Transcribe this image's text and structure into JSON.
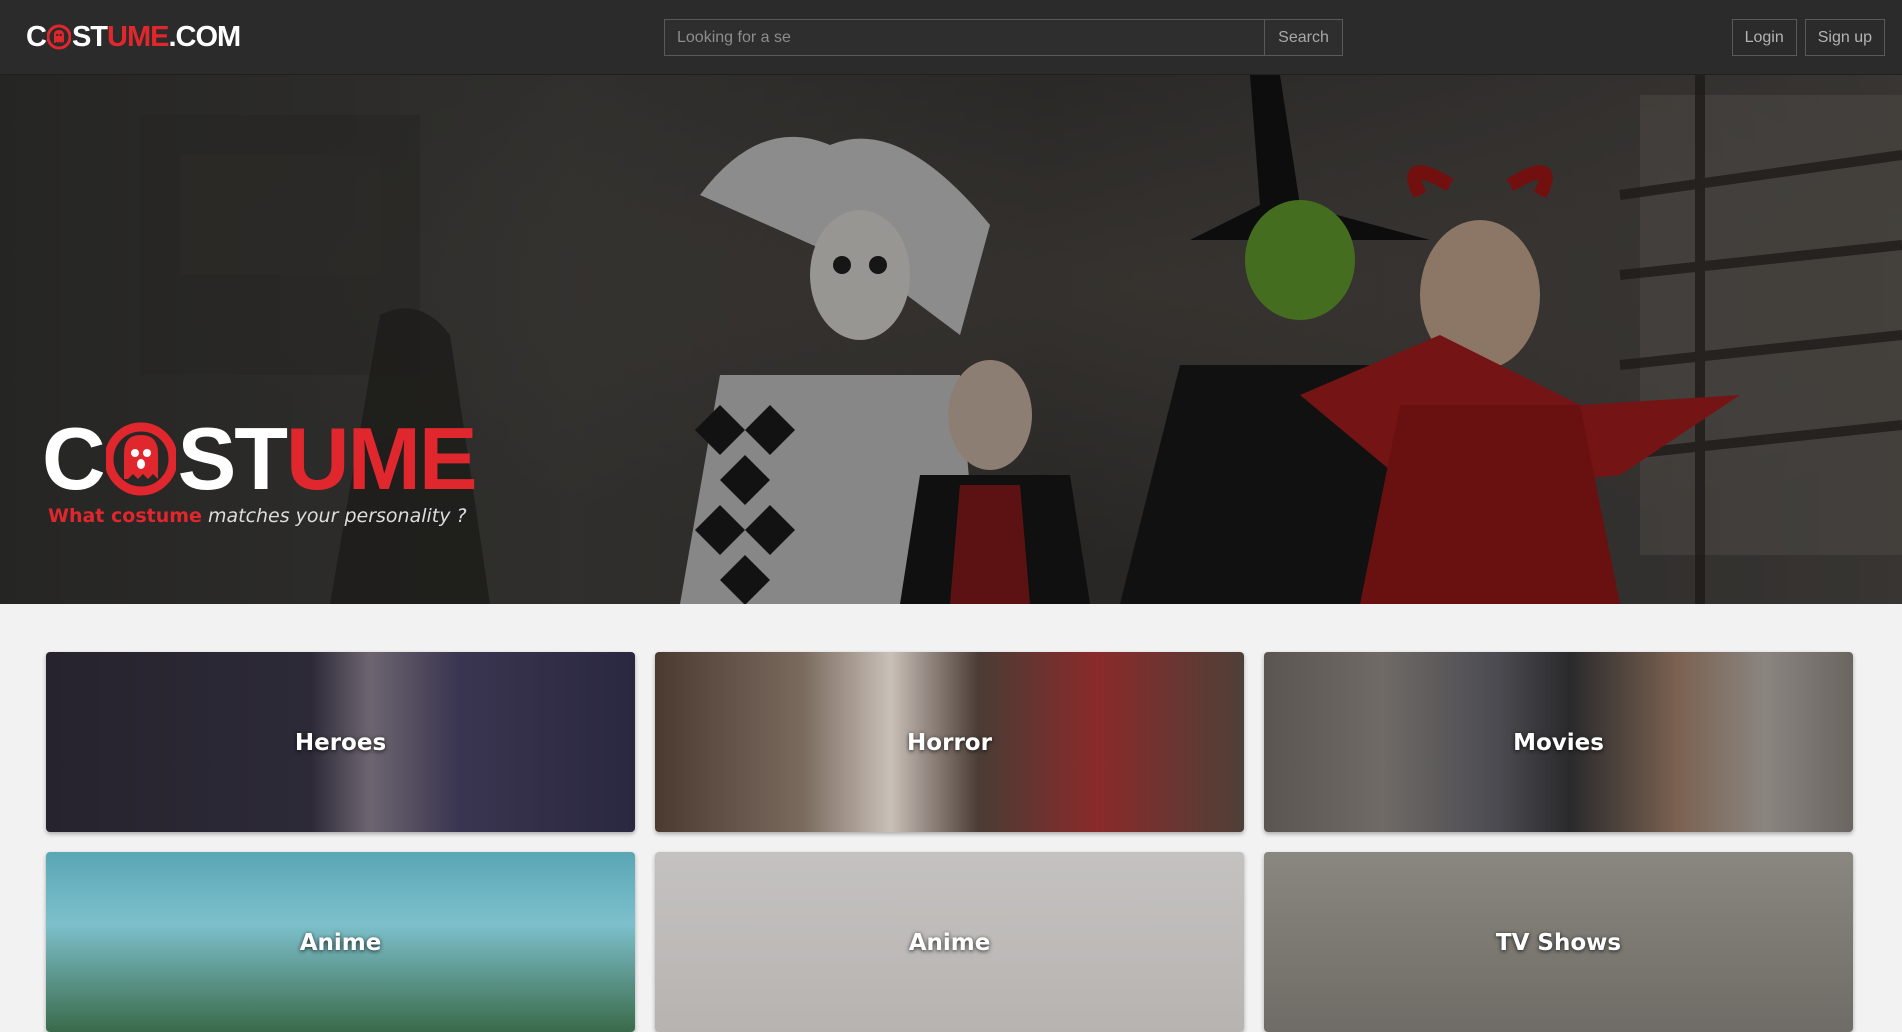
{
  "navbar": {
    "brand": {
      "part1": "C",
      "part2": "ST",
      "part3": "UME",
      "part4": ".COM"
    },
    "search": {
      "placeholder": "Looking for a se",
      "button_label": "Search"
    },
    "auth": {
      "login_label": "Login",
      "signup_label": "Sign up"
    }
  },
  "hero": {
    "logo": {
      "part1": "C",
      "part2": "ST",
      "part3": "UME"
    },
    "tagline": {
      "highlight": "What costume",
      "rest": "matches your personality ?"
    }
  },
  "categories": [
    {
      "label": "Heroes"
    },
    {
      "label": "Horror"
    },
    {
      "label": "Movies"
    },
    {
      "label": "Anime"
    },
    {
      "label": "Anime"
    },
    {
      "label": "TV Shows"
    }
  ],
  "colors": {
    "accent": "#e0272d",
    "navbar": "#2b2b2b",
    "page_bg": "#f2f2f2"
  }
}
